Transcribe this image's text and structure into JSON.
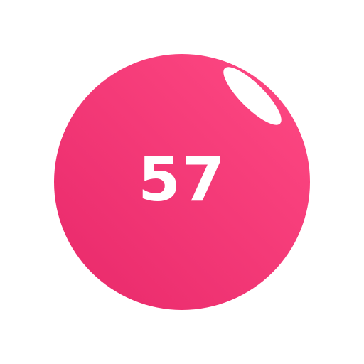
{
  "ball": {
    "number": "57",
    "color_light": "#ff4a84",
    "color_dark": "#e8286a",
    "highlight_color": "#ffffff",
    "text_color": "#ffffff"
  }
}
